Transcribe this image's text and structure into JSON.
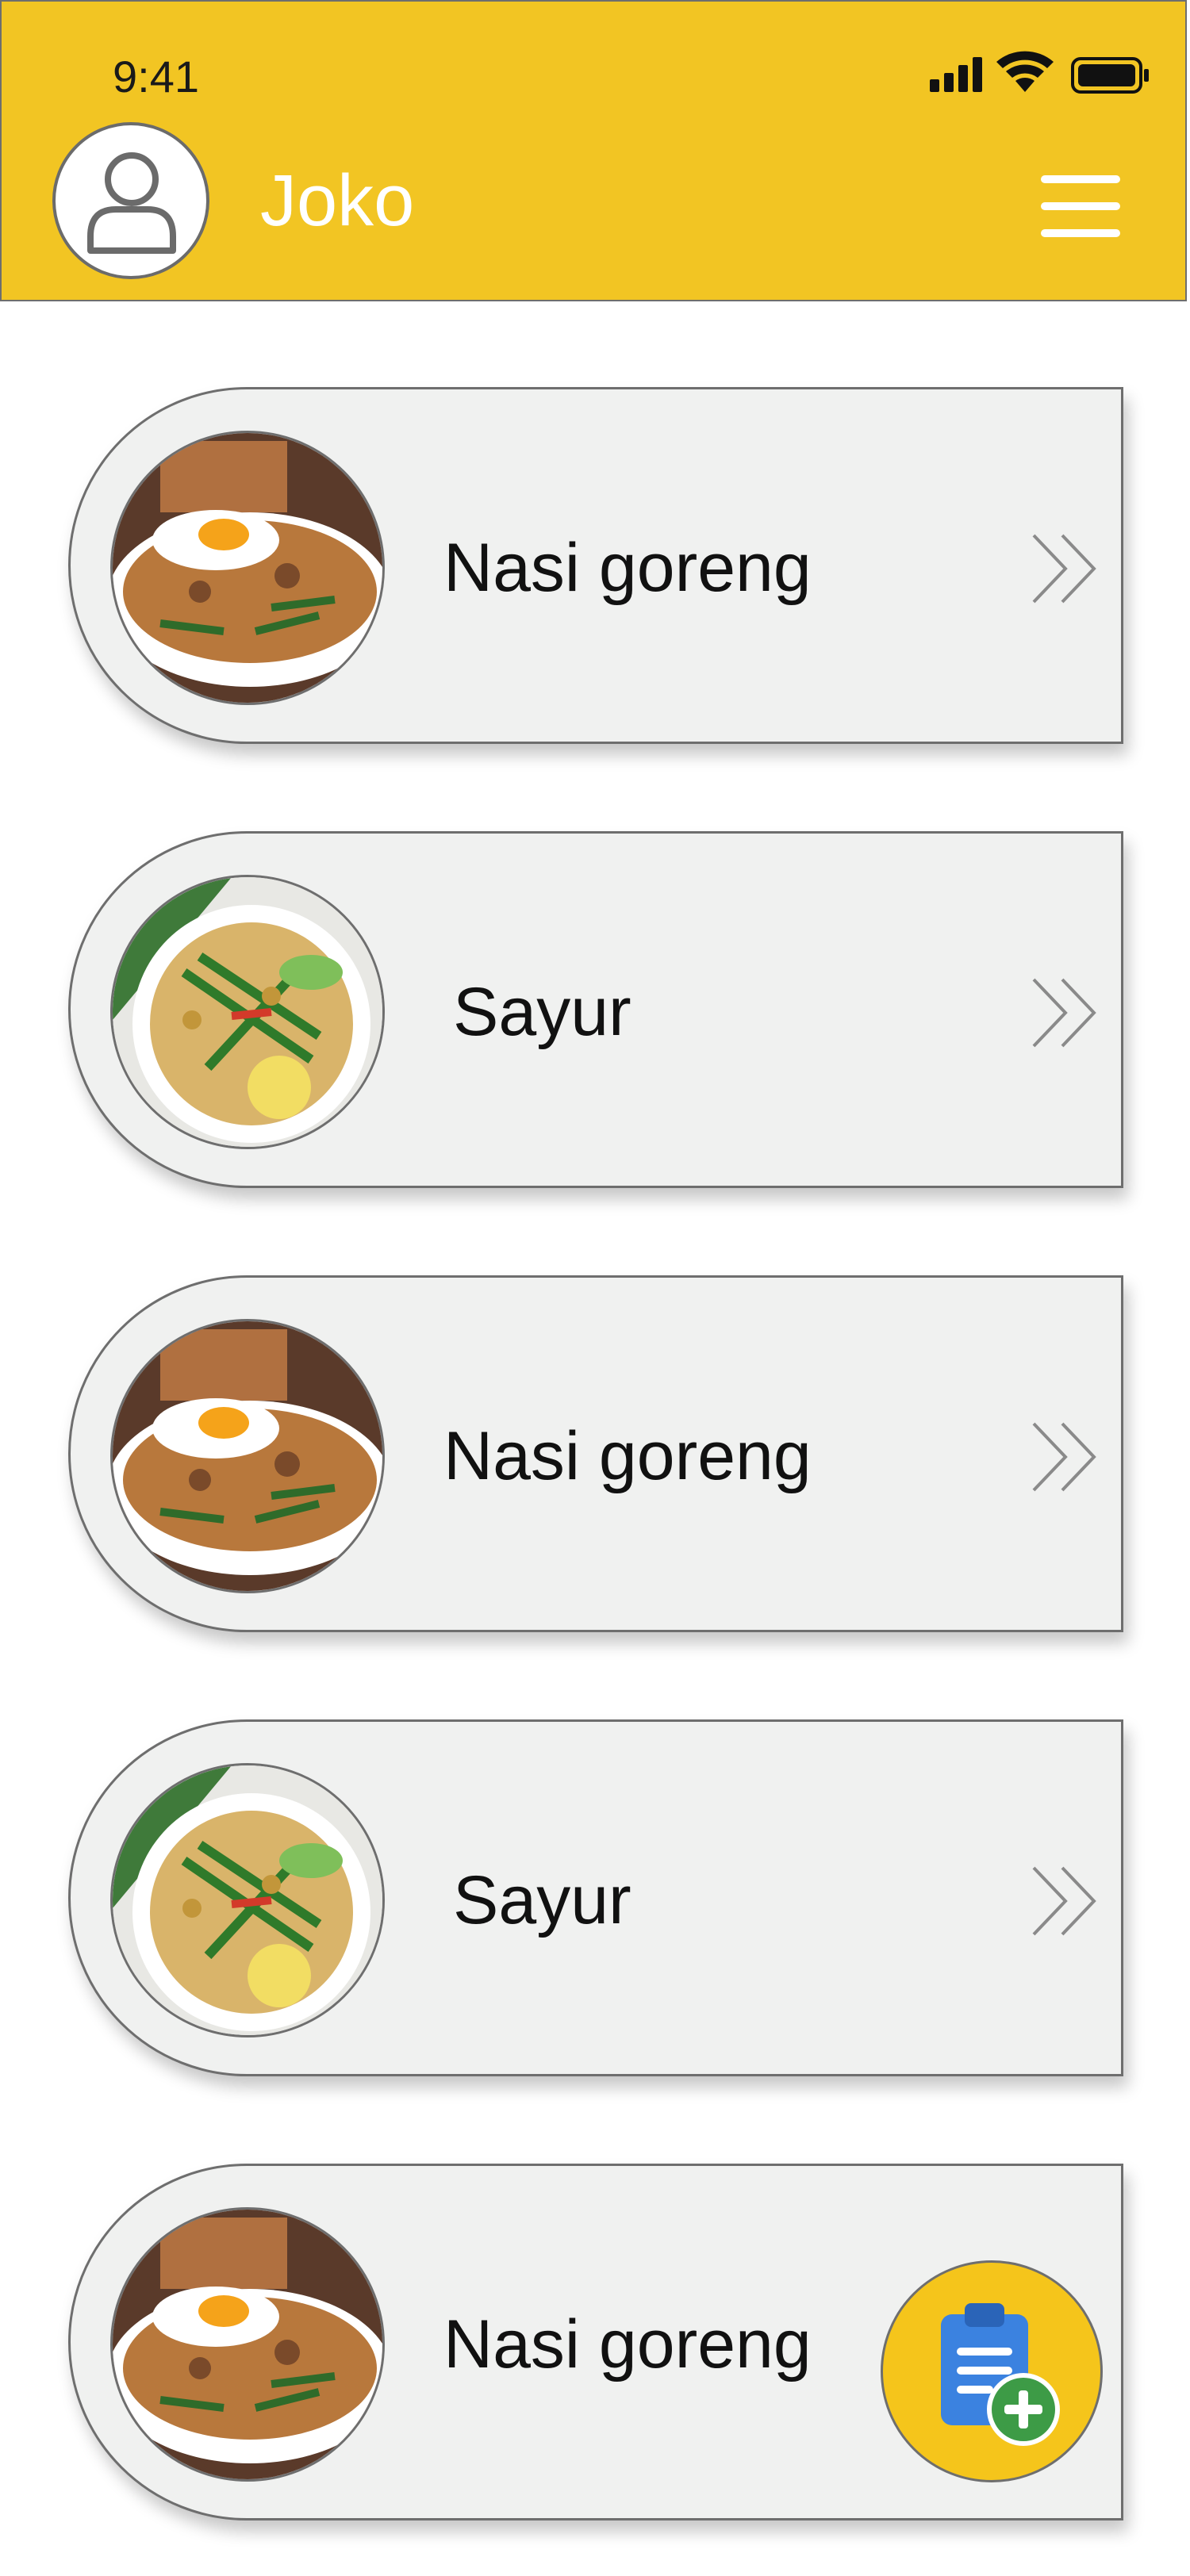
{
  "status_bar": {
    "time": "9:41"
  },
  "header": {
    "username": "Joko"
  },
  "cards": [
    {
      "title": "Nasi goreng",
      "image": "nasi-goreng"
    },
    {
      "title": "Sayur",
      "image": "sayur"
    },
    {
      "title": "Nasi goreng",
      "image": "nasi-goreng"
    },
    {
      "title": "Sayur",
      "image": "sayur"
    },
    {
      "title": "Nasi goreng",
      "image": "nasi-goreng"
    }
  ],
  "icons": {
    "avatar": "user-outline-icon",
    "menu": "hamburger-menu-icon",
    "chevron": "double-chevron-right-icon",
    "fab": "clipboard-add-icon"
  },
  "colors": {
    "header": "#f2c523",
    "card": "#f0f1f0",
    "fab": "#f5c51b",
    "fab_plus": "#3d9b46",
    "clipboard": "#3b82e0"
  }
}
